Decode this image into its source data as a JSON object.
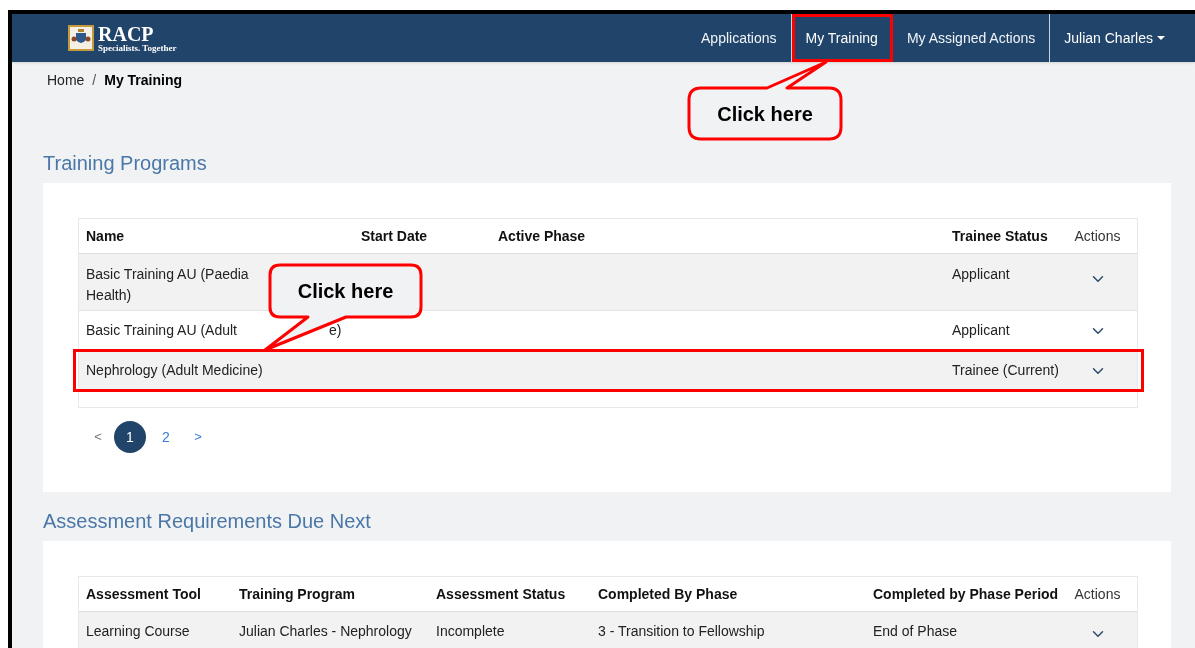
{
  "header": {
    "logo_title": "RACP",
    "logo_tagline": "Specialists. Together",
    "nav": [
      {
        "label": "Applications",
        "selected": false,
        "highlighted": false
      },
      {
        "label": "My Training",
        "selected": true,
        "highlighted": true
      },
      {
        "label": "My Assigned Actions",
        "selected": false,
        "highlighted": false
      }
    ],
    "user_menu": "Julian Charles"
  },
  "breadcrumb": {
    "separator": "/",
    "items": [
      {
        "label": "Home",
        "current": false
      },
      {
        "label": "My Training",
        "current": true
      }
    ]
  },
  "callouts": [
    {
      "text": "Click here"
    },
    {
      "text": "Click here"
    }
  ],
  "training_programs": {
    "title": "Training Programs",
    "columns": [
      "Name",
      "Start Date",
      "Active Phase",
      "Trainee Status",
      "Actions"
    ],
    "rows": [
      {
        "name_parts": [
          "Basic Training AU (Paedia",
          "Health)"
        ],
        "status": "Applicant",
        "highlighted": false,
        "striped": true
      },
      {
        "name_parts": [
          "Basic Training AU (Adult",
          "e)"
        ],
        "status": "Applicant",
        "highlighted": false,
        "striped": false
      },
      {
        "name_parts": [
          "Nephrology (Adult Medicine)"
        ],
        "status": "Trainee (Current)",
        "highlighted": true,
        "striped": true
      }
    ],
    "pagination": {
      "prev": "<",
      "next": ">",
      "pages": [
        {
          "label": "1",
          "selected": true
        },
        {
          "label": "2",
          "selected": false
        }
      ]
    }
  },
  "assessments": {
    "title": "Assessment Requirements Due Next",
    "columns": [
      "Assessment Tool",
      "Training Program",
      "Assessment Status",
      "Completed By Phase",
      "Completed by Phase Period",
      "Actions"
    ],
    "rows": [
      {
        "cells": [
          "Learning Course",
          "Julian Charles - Nephrology",
          "Incomplete",
          "3 - Transition to Fellowship",
          "End of Phase"
        ]
      }
    ]
  }
}
